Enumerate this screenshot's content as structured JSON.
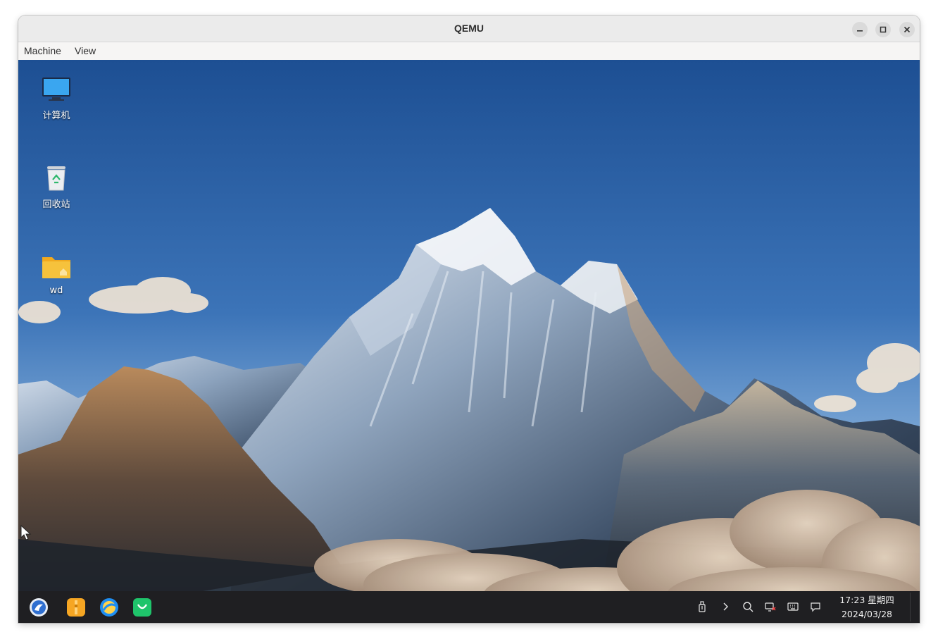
{
  "window": {
    "title": "QEMU",
    "controls": [
      "minimize-icon",
      "maximize-icon",
      "close-icon"
    ]
  },
  "menubar": {
    "items": [
      {
        "label": "Machine"
      },
      {
        "label": "View"
      }
    ]
  },
  "desktop": {
    "icons": [
      {
        "label": "计算机",
        "icon": "computer-icon"
      },
      {
        "label": "回收站",
        "icon": "trash-icon"
      },
      {
        "label": "wd",
        "icon": "home-folder-icon"
      }
    ]
  },
  "taskbar": {
    "apps": [
      "start-menu-icon",
      "file-manager-icon",
      "browser-icon",
      "app-store-icon"
    ],
    "tray": [
      "usb-icon",
      "expand-tray-icon",
      "search-icon",
      "network-disconnected-icon",
      "keyboard-icon",
      "notification-icon"
    ],
    "clock": {
      "time_weekday": "17:23 星期四",
      "date": "2024/03/28"
    }
  },
  "colors": {
    "taskbar_bg": "#1f1f22",
    "sky_top": "#1d4f93",
    "sky_bottom": "#8fb7df",
    "folder": "#f6c23c"
  }
}
